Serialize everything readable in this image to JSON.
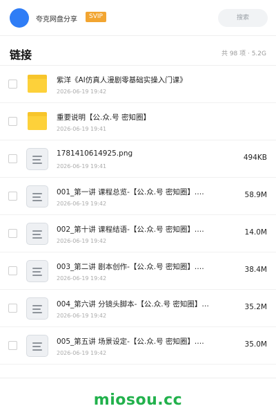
{
  "header": {
    "share_name": "夸克网盘分享",
    "badge": "SVIP",
    "search_label": "搜索"
  },
  "section": {
    "title": "链接",
    "meta": "共 98 项 · 5.2G"
  },
  "files": [
    {
      "name": "紫洋《AI仿真人漫剧零基础实操入门课》",
      "date": "2026-06-19 19:42",
      "size": "",
      "icon": "folder-icon"
    },
    {
      "name": "重要说明【公.众.号 密知圈】",
      "date": "2026-06-19 19:41",
      "size": "",
      "icon": "folder-icon"
    },
    {
      "name": "1781410614925.png",
      "date": "2026-06-19 19:41",
      "size": "494KB",
      "icon": "document-icon"
    },
    {
      "name": "001_第一讲 课程总览-【公.众.号 密知圈】.…",
      "date": "2026-06-19 19:42",
      "size": "58.9M",
      "icon": "document-icon"
    },
    {
      "name": "002_第十讲 课程结语-【公.众.号 密知圈】.…",
      "date": "2026-06-19 19:42",
      "size": "14.0M",
      "icon": "document-icon"
    },
    {
      "name": "003_第二讲 剧本创作-【公.众.号 密知圈】.…",
      "date": "2026-06-19 19:42",
      "size": "38.4M",
      "icon": "document-icon"
    },
    {
      "name": "004_第六讲 分镜头脚本-【公.众.号 密知圈】…",
      "date": "2026-06-19 19:42",
      "size": "35.2M",
      "icon": "document-icon"
    },
    {
      "name": "005_第五讲 场景设定-【公.众.号 密知圈】.…",
      "date": "2026-06-19 19:42",
      "size": "35.0M",
      "icon": "document-icon"
    }
  ],
  "watermark": "miosou.cc",
  "colors": {
    "avatar": "#2f7df6",
    "badge": "#f2a531",
    "folder": "#fdd13a",
    "watermark": "#22b14c"
  }
}
